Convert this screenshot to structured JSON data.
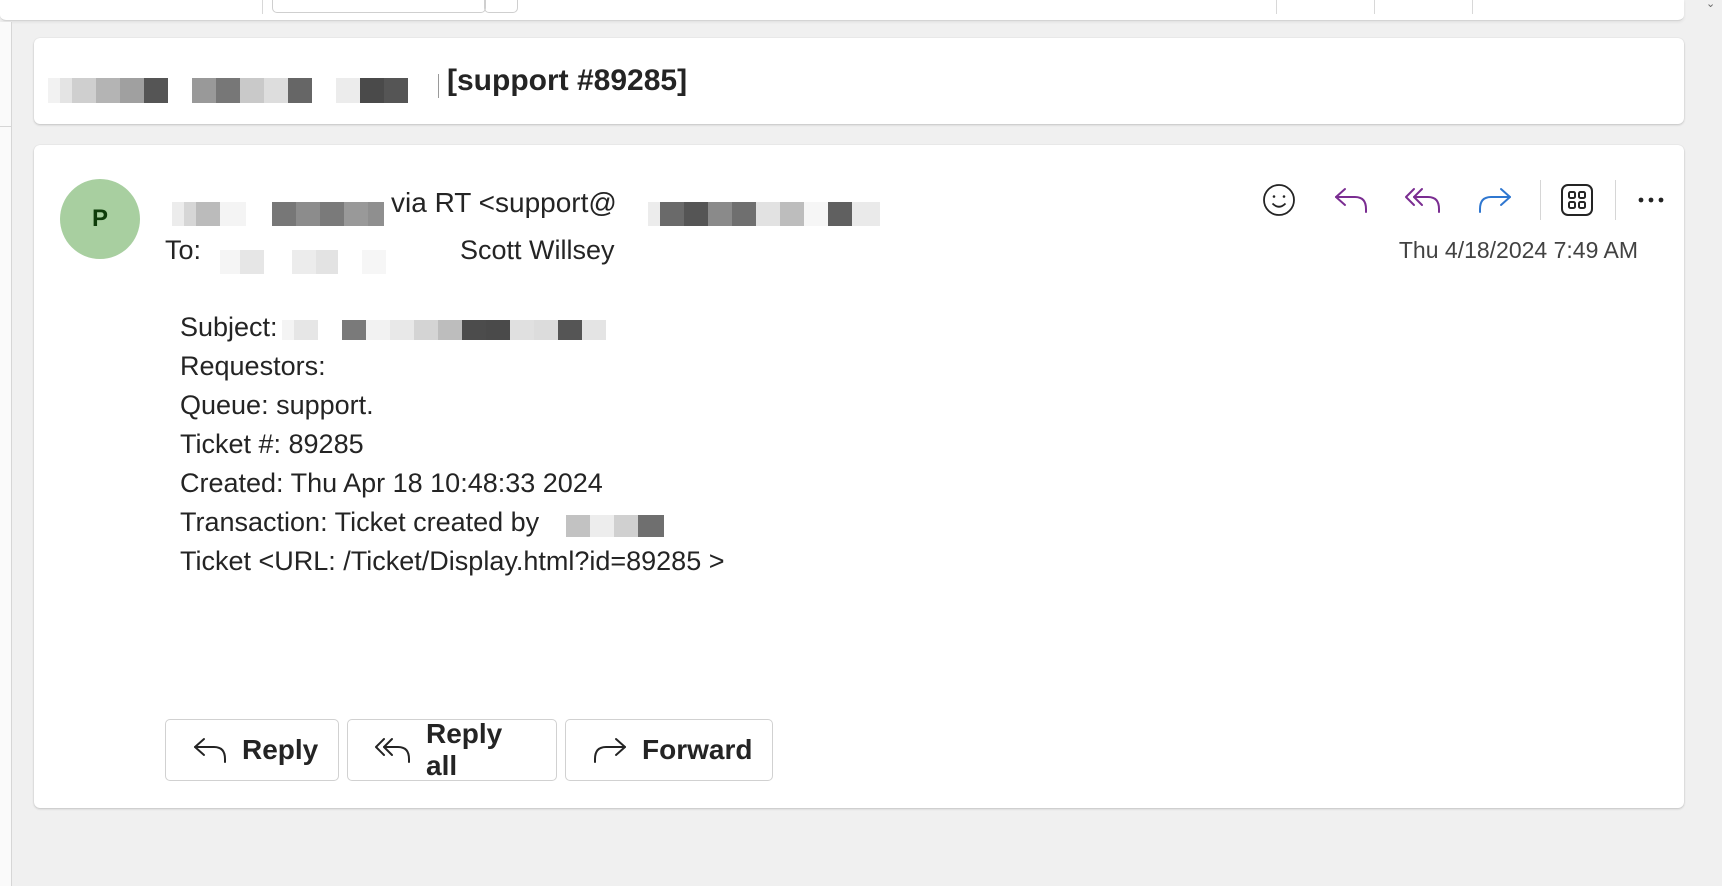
{
  "colors": {
    "accent_reply": "#7a2d91",
    "accent_forward": "#2f77d0",
    "avatar_bg": "#a8cfa0",
    "avatar_text": "#0e3c0a"
  },
  "subject": {
    "tag": "[support #89285]"
  },
  "message": {
    "avatar_initial": "P",
    "from_suffix": "via RT <support@",
    "to_label": "To:",
    "to_name": "Scott Willsey",
    "date": "Thu 4/18/2024 7:49 AM",
    "actions": [
      {
        "icon": "emoji-icon"
      },
      {
        "icon": "reply-icon"
      },
      {
        "icon": "reply-all-icon"
      },
      {
        "icon": "forward-icon"
      },
      {
        "icon": "apps-icon"
      },
      {
        "icon": "more-icon"
      }
    ],
    "body": {
      "subject_label": "Subject:",
      "requestors": "Requestors:",
      "queue": "Queue: support.",
      "ticket_no": "Ticket #: 89285",
      "created": "Created: Thu Apr 18 10:48:33 2024",
      "transaction": "Transaction: Ticket created by",
      "ticket_url": "Ticket <URL: /Ticket/Display.html?id=89285 >"
    }
  },
  "buttons": {
    "reply": "Reply",
    "reply_all": "Reply all",
    "forward": "Forward"
  }
}
